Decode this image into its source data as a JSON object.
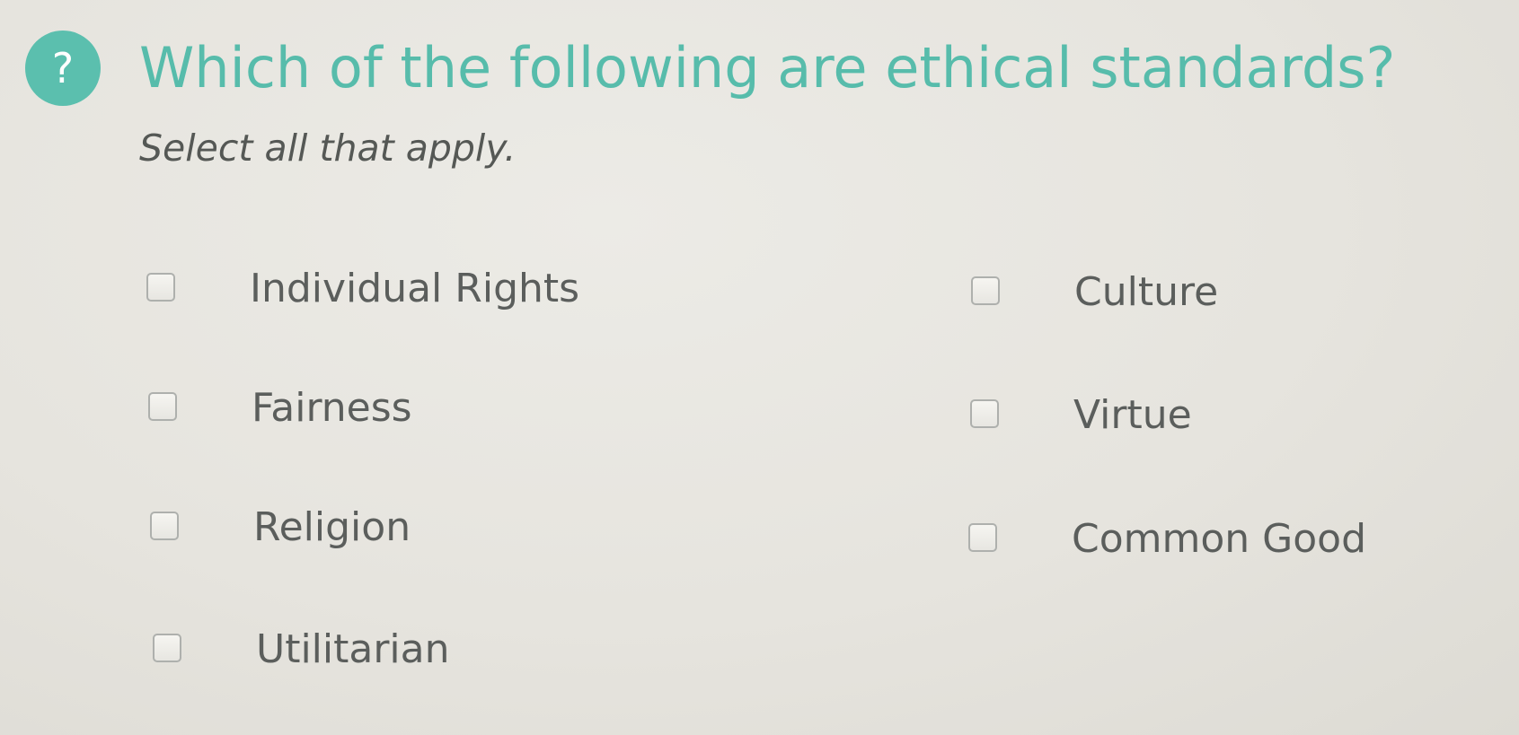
{
  "question": {
    "badge_symbol": "?",
    "title": "Which of the following are ethical standards?",
    "instructions": "Select all that apply."
  },
  "options": {
    "left": [
      {
        "label": "Individual Rights",
        "checked": false
      },
      {
        "label": "Fairness",
        "checked": false
      },
      {
        "label": "Religion",
        "checked": false
      },
      {
        "label": "Utilitarian",
        "checked": false
      }
    ],
    "right": [
      {
        "label": "Culture",
        "checked": false
      },
      {
        "label": "Virtue",
        "checked": false
      },
      {
        "label": "Common Good",
        "checked": false
      }
    ]
  },
  "colors": {
    "accent": "#57bcab",
    "badge": "#5bbfae",
    "text": "#5b5e5c",
    "background": "#e6e4de"
  }
}
